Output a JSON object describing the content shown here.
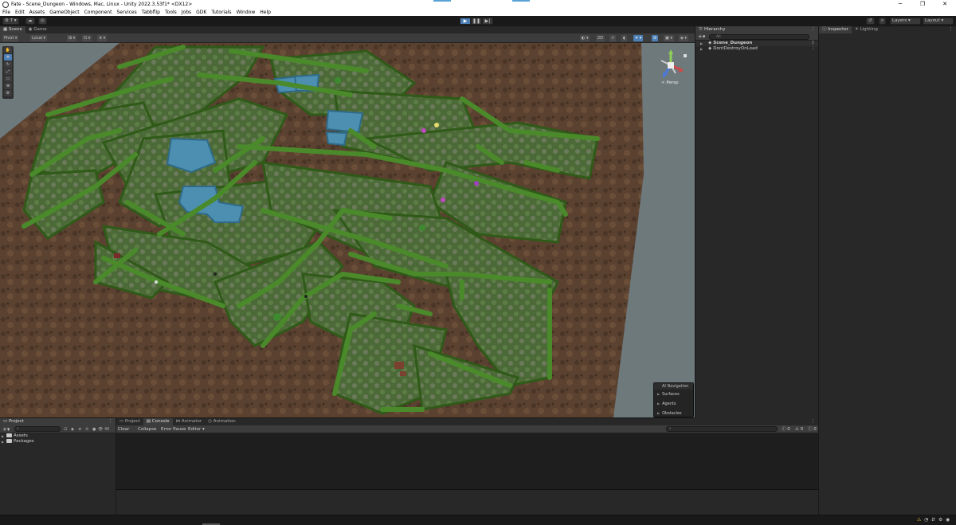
{
  "window": {
    "title": "Fate - Scene_Dungeon - Windows, Mac, Linux - Unity 2022.3.53f1* <DX12>",
    "minimize": "─",
    "maximize": "❐",
    "close": "✕"
  },
  "menu": [
    "File",
    "Edit",
    "Assets",
    "GameObject",
    "Component",
    "Services",
    "Tabbflip",
    "Tools",
    "Jobs",
    "GDK",
    "Tutorials",
    "Window",
    "Help"
  ],
  "toolbar": {
    "account": "⚙ T ▾",
    "cloud": "☁",
    "collab": "◎",
    "play": "▶",
    "pause": "❚❚",
    "step": "▶|",
    "history": "↺",
    "search": "⌕",
    "layers": "Layers",
    "layout": "Layout"
  },
  "scene_tabs": [
    "Scene",
    "Game"
  ],
  "scene_toolbar": {
    "pivot": "Pivot ▾",
    "local": "Local ▾",
    "grid": "⊞ ▾",
    "snap": "⊡ ▾",
    "increment": "⋔ ▾",
    "shading": "◐ ▾",
    "mode_2d": "2D",
    "light": "☼",
    "audio": "◖",
    "fx": "✦ ▾",
    "hidden": "⊘",
    "camera": "▣ ▾",
    "gizmos": "◈ ▾"
  },
  "tools": [
    "✋",
    "✥",
    "↻",
    "⤢",
    "▭",
    "⊕",
    "⚙"
  ],
  "gizmo": {
    "persp_label": "< Persp",
    "y": "y",
    "x": "x",
    "z": "z"
  },
  "ai_navigation": {
    "title": "AI Navigation",
    "items": [
      "Surfaces",
      "Agents",
      "Obstacles"
    ]
  },
  "hierarchy": {
    "tab": "Hierarchy",
    "search_placeholder": "All",
    "rows": [
      {
        "label": "Scene_Dungeon",
        "bold": true
      },
      {
        "label": "DontDestroyOnLoad",
        "bold": false
      }
    ]
  },
  "inspector": {
    "tabs": [
      "Inspector",
      "Lighting"
    ]
  },
  "project": {
    "tab": "Project",
    "count": "46",
    "search_placeholder": "",
    "rows": [
      "Assets",
      "Packages"
    ]
  },
  "console": {
    "tabs": [
      "Project",
      "Console",
      "Animator",
      "Animation"
    ],
    "buttons": [
      "Clear",
      "Collapse",
      "Error Pause",
      "Editor ▾"
    ],
    "counters": [
      "0",
      "0",
      "0"
    ]
  },
  "colors": {
    "accent": "#4c7fb5",
    "panel": "#282828",
    "viewport_bg": "#6e797c",
    "dirt": "#5a4130",
    "hedge": "#3e6a22",
    "grass": "#4f6b3a",
    "water": "#4d8fb0"
  }
}
